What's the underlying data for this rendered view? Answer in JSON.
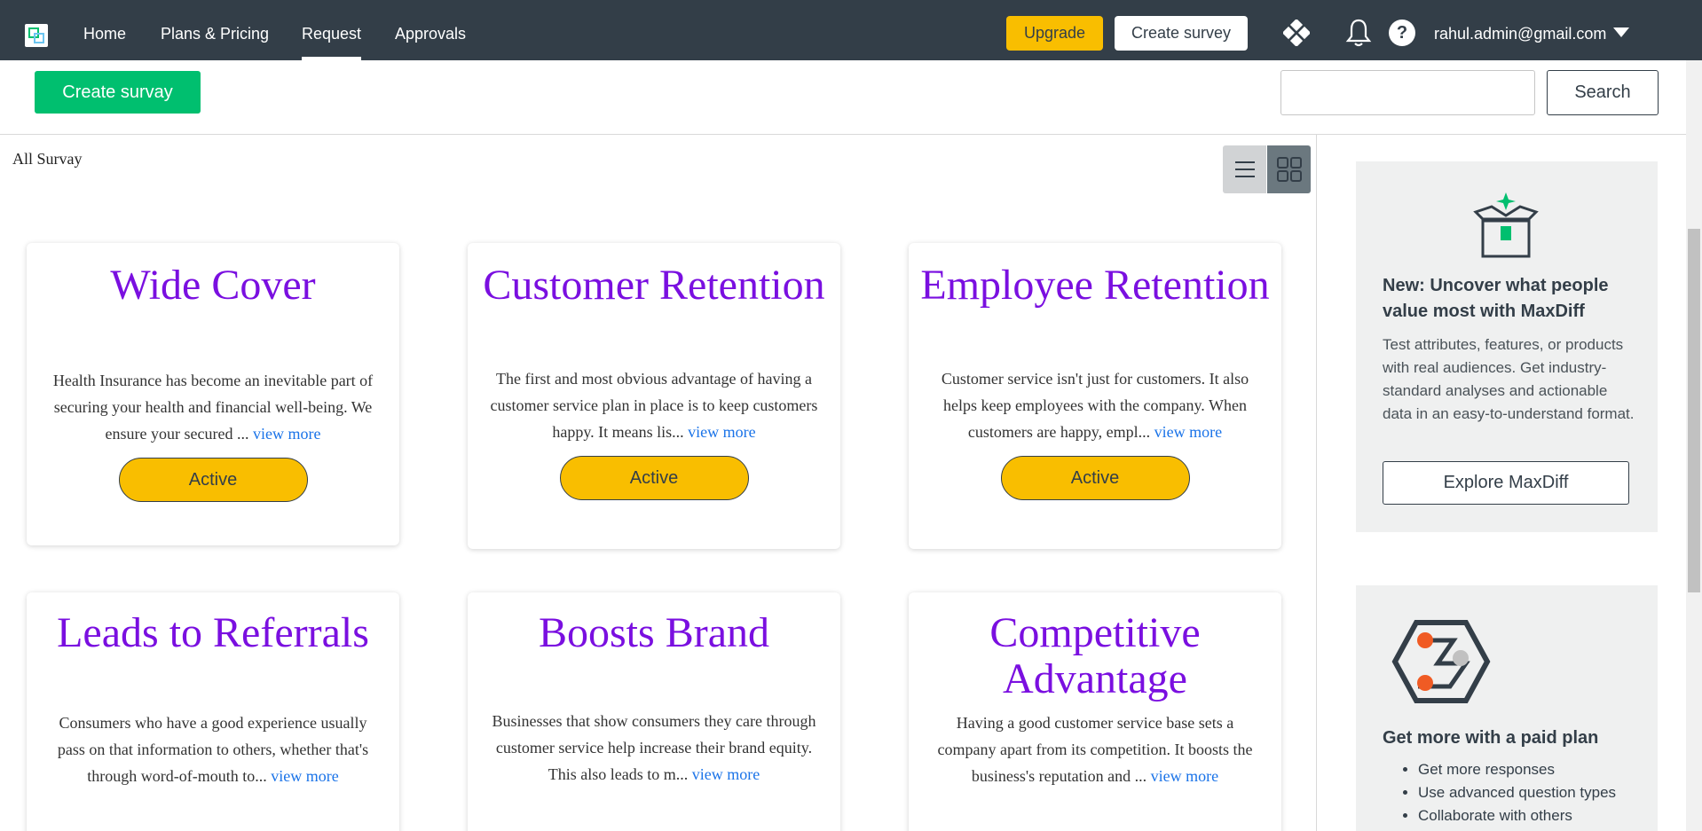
{
  "nav": {
    "links": [
      "Home",
      "Plans & Pricing",
      "Request",
      "Approvals"
    ],
    "active_index": 2,
    "upgrade_label": "Upgrade",
    "create_survey_label": "Create survey",
    "help_glyph": "?",
    "user_email": "rahul.admin@gmail.com",
    "icons": [
      "logo-icon",
      "apps-icon",
      "bell-icon",
      "help-icon",
      "chevron-down-icon"
    ]
  },
  "toolbar": {
    "create_label": "Create survay",
    "search_value": "",
    "search_placeholder": "",
    "search_label": "Search"
  },
  "section": {
    "title": "All Survay",
    "view_modes": [
      "list",
      "grid"
    ],
    "selected_view": "grid"
  },
  "cards": [
    {
      "title": "Wide Cover",
      "description": "Health Insurance has become an inevitable part of securing your health and financial well-being. We ensure your secured ...",
      "link": "view more",
      "status": "Active"
    },
    {
      "title": "Customer Retention",
      "description": "The first and most obvious advantage of having a customer service plan in place is to keep customers happy. It means lis...",
      "link": "view more",
      "status": "Active"
    },
    {
      "title": "Employee Retention",
      "description": "Customer service isn't just for customers. It also helps keep employees with the company. When customers are happy, empl...",
      "link": "view more",
      "status": "Active"
    },
    {
      "title": "Leads to Referrals",
      "description": "Consumers who have a good experience usually pass on that information to others, whether that's through word-of-mouth to...",
      "link": "view more"
    },
    {
      "title": "Boosts Brand",
      "description": "Businesses that show consumers they care through customer service help increase their brand equity. This also leads to m...",
      "link": "view more"
    },
    {
      "title": "Competitive Advantage",
      "description": "Having a good customer service base sets a company apart from its competition. It boosts the business's reputation and ...",
      "link": "view more"
    }
  ],
  "promo_maxdiff": {
    "title": "New: Uncover what people value most with MaxDiff",
    "body": "Test attributes, features, or products with real audiences. Get industry-standard analyses and actionable data in an easy-to-understand format.",
    "button": "Explore MaxDiff",
    "icon": "gift-box-icon"
  },
  "promo_paid": {
    "title": "Get more with a paid plan",
    "items": [
      "Get more responses",
      "Use advanced question types",
      "Collaborate with others"
    ],
    "icon": "path-hexagon-icon"
  },
  "colors": {
    "nav_bg": "#333e48",
    "accent_yellow": "#f9be00",
    "accent_green": "#00bf6f",
    "title_purple": "#7a0fe0",
    "link_blue": "#1a73e8"
  }
}
